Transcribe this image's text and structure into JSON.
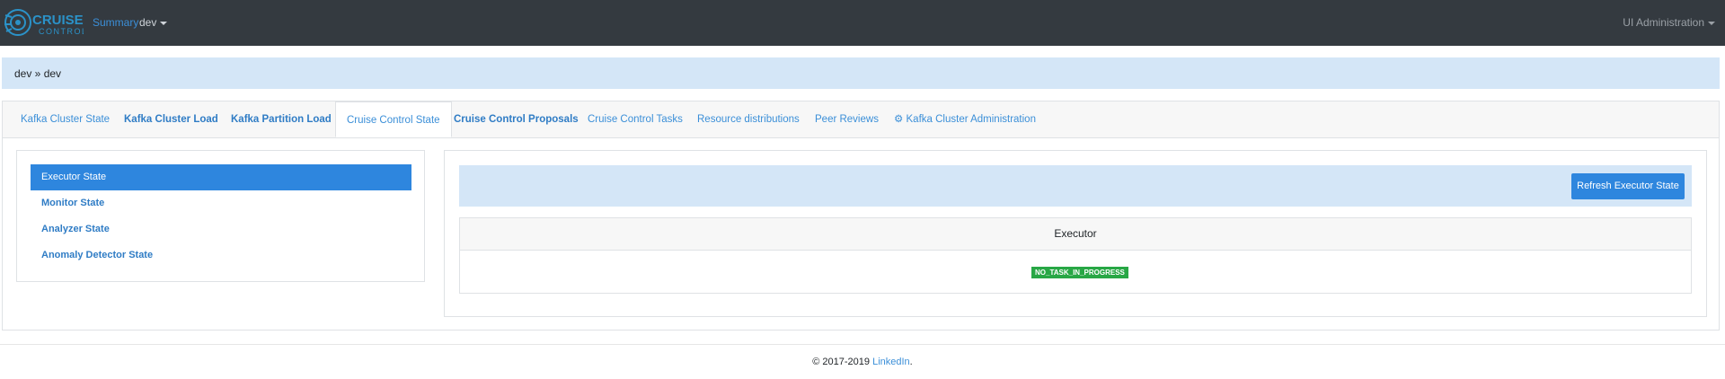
{
  "navbar": {
    "logo_text_top": "CRUISE",
    "logo_text_bottom": "CONTROL",
    "summary_link": "Summary",
    "cluster_dropdown": "dev",
    "admin_dropdown": "UI Administration"
  },
  "breadcrumb": "dev » dev",
  "tabs": [
    {
      "label": "Kafka Cluster State"
    },
    {
      "label": "Kafka Cluster Load"
    },
    {
      "label": "Kafka Partition Load"
    },
    {
      "label": "Cruise Control State"
    },
    {
      "label": "Cruise Control Proposals"
    },
    {
      "label": "Cruise Control Tasks"
    },
    {
      "label": "Resource distributions"
    },
    {
      "label": "Peer Reviews"
    },
    {
      "label": "Kafka Cluster Administration"
    }
  ],
  "sidebar": {
    "items": [
      {
        "label": "Executor State"
      },
      {
        "label": "Monitor State"
      },
      {
        "label": "Analyzer State"
      },
      {
        "label": "Anomaly Detector State"
      }
    ]
  },
  "main": {
    "refresh_button": "Refresh Executor State",
    "table_header": "Executor",
    "status_badge": "NO_TASK_IN_PROGRESS"
  },
  "footer": {
    "copyright": "© 2017-2019",
    "link": "LinkedIn",
    "suffix": "."
  },
  "colors": {
    "navbar_bg": "#343a40",
    "accent": "#2e86de",
    "link": "#3b8fd8",
    "highlight_bg": "#d4e6f7",
    "success": "#28a745"
  },
  "icons": {
    "logo": "cruise-control-logo",
    "settings": "gear-icon"
  }
}
